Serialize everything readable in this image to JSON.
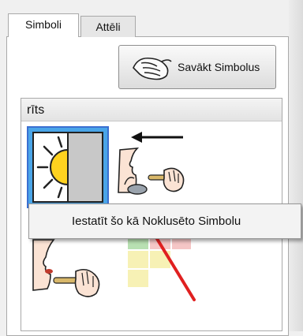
{
  "tabs": [
    {
      "label": "Simboli",
      "active": true
    },
    {
      "label": "Attēli",
      "active": false
    }
  ],
  "capture_button": {
    "label": "Savākt Simbolus",
    "icon": "hand-capture-icon"
  },
  "symbol_group": {
    "title": "rīts",
    "symbols": [
      {
        "icon": "sunrise-icon",
        "selected": true
      },
      {
        "icon": "person-toothbrush-icon",
        "selected": false
      },
      {
        "icon": "person-brushing-teeth-icon",
        "selected": false
      },
      {
        "icon": "crossed-out-squares-icon",
        "selected": false
      }
    ]
  },
  "context_menu": {
    "items": [
      {
        "label": "Iestatīt šo kā Noklusēto Simbolu"
      }
    ]
  },
  "colors": {
    "selection_blue": "#4aa5e8",
    "selection_border": "#3b6fd1",
    "cross_red": "#e02020",
    "sun_yellow": "#ffd21f"
  }
}
